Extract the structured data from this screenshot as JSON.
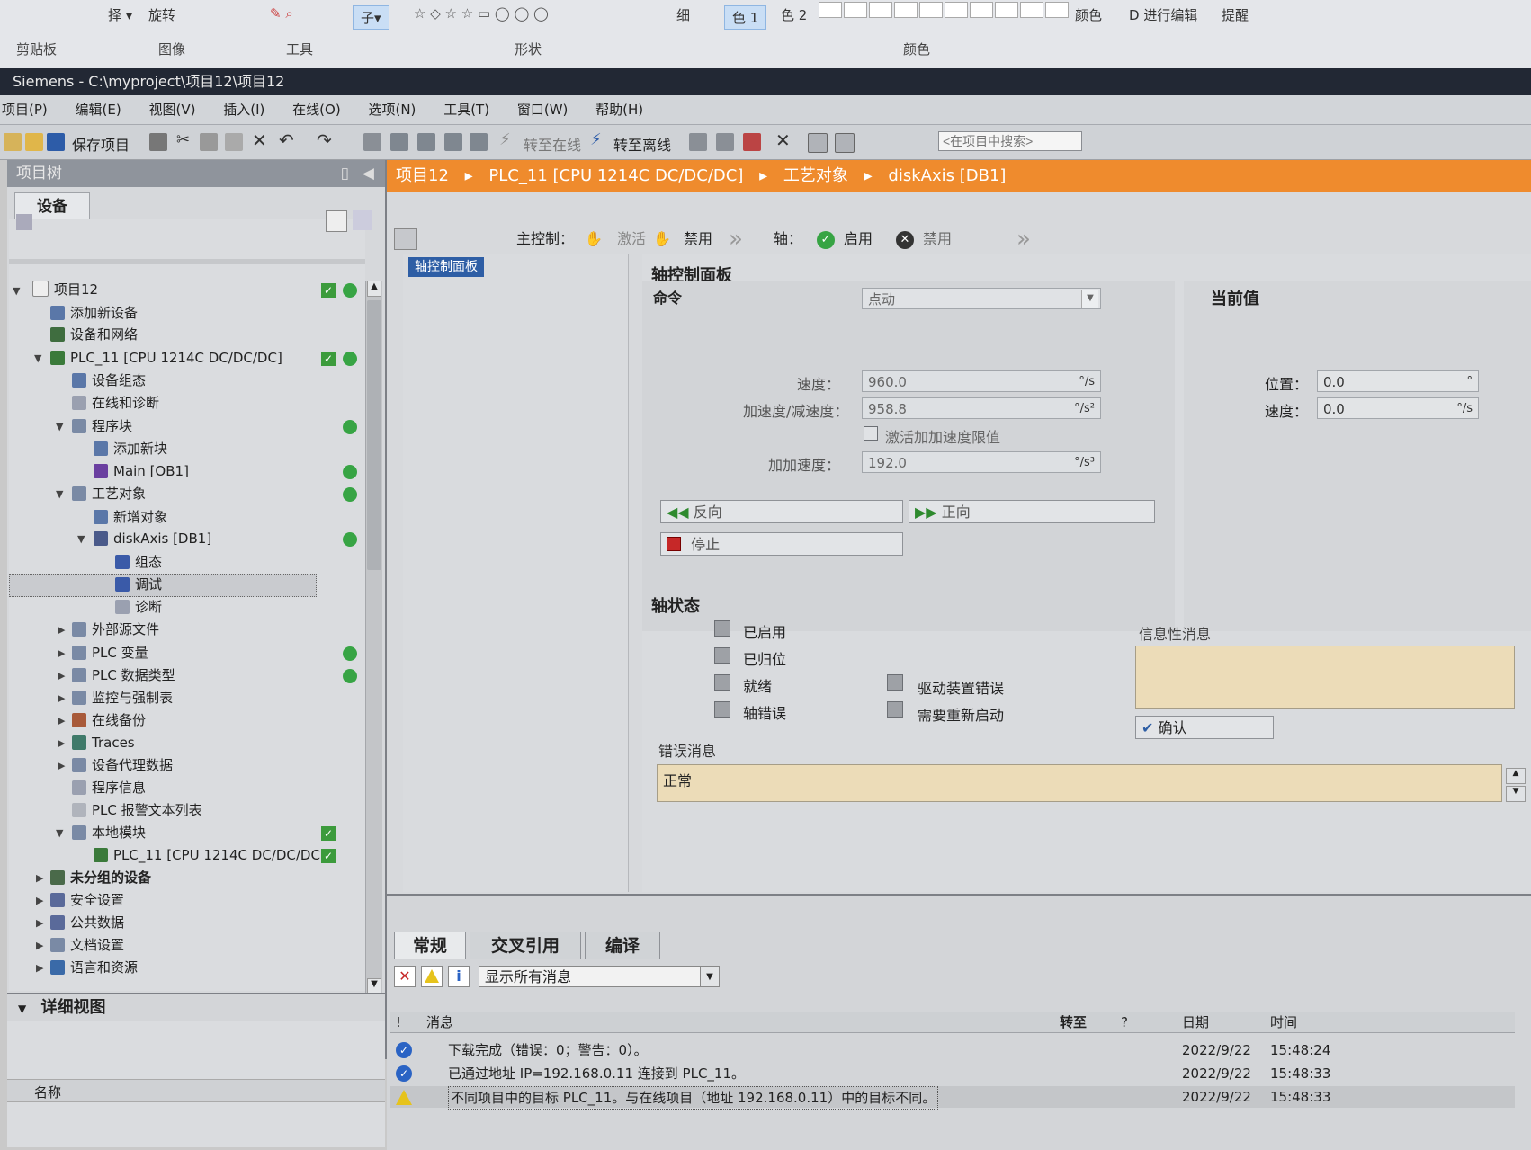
{
  "ribbon": {
    "clipboard": "剪贴板",
    "image": "图像",
    "tools": "工具",
    "shapes": "形状",
    "colors": "颜色",
    "rotate": "旋转",
    "size": "细",
    "color1": "色 1",
    "color2": "色 2",
    "edit_colors": "颜色",
    "edit_3d": "D 进行编辑",
    "tip": "提醒"
  },
  "window": {
    "title": "Siemens  -  C:\\myproject\\项目12\\项目12"
  },
  "menu": [
    "项目(P)",
    "编辑(E)",
    "视图(V)",
    "插入(I)",
    "在线(O)",
    "选项(N)",
    "工具(T)",
    "窗口(W)",
    "帮助(H)"
  ],
  "toolbar": {
    "save": "保存项目",
    "go_online": "转至在线",
    "go_offline": "转至离线",
    "search_placeholder": "<在项目中搜索>"
  },
  "tree": {
    "header": "项目树",
    "tab": "设备",
    "items": [
      {
        "label": "项目12"
      },
      {
        "label": "添加新设备"
      },
      {
        "label": "设备和网络"
      },
      {
        "label": "PLC_11 [CPU 1214C DC/DC/DC]"
      },
      {
        "label": "设备组态"
      },
      {
        "label": "在线和诊断"
      },
      {
        "label": "程序块"
      },
      {
        "label": "添加新块"
      },
      {
        "label": "Main [OB1]"
      },
      {
        "label": "工艺对象"
      },
      {
        "label": "新增对象"
      },
      {
        "label": "diskAxis [DB1]"
      },
      {
        "label": "组态"
      },
      {
        "label": "调试"
      },
      {
        "label": "诊断"
      },
      {
        "label": "外部源文件"
      },
      {
        "label": "PLC 变量"
      },
      {
        "label": "PLC 数据类型"
      },
      {
        "label": "监控与强制表"
      },
      {
        "label": "在线备份"
      },
      {
        "label": "Traces"
      },
      {
        "label": "设备代理数据"
      },
      {
        "label": "程序信息"
      },
      {
        "label": "PLC 报警文本列表"
      },
      {
        "label": "本地模块"
      },
      {
        "label": "PLC_11 [CPU 1214C DC/DC/DC]"
      },
      {
        "label": "未分组的设备"
      },
      {
        "label": "安全设置"
      },
      {
        "label": "公共数据"
      },
      {
        "label": "文档设置"
      },
      {
        "label": "语言和资源"
      }
    ],
    "detail_view": "详细视图",
    "detail_col_name": "名称"
  },
  "breadcrumb": [
    "项目12",
    "PLC_11 [CPU 1214C DC/DC/DC]",
    "工艺对象",
    "diskAxis [DB1]"
  ],
  "editor_toolbar": {
    "master_control": "主控制：",
    "activate": "激活",
    "disable": "禁用",
    "axis": "轴：",
    "enable": "启用",
    "axis_disable": "禁用"
  },
  "nav": {
    "item": "轴控制面板"
  },
  "panel": {
    "title": "轴控制面板",
    "command_label": "命令",
    "command_value": "点动",
    "current_label": "当前值",
    "speed_label": "速度：",
    "speed_value": "960.0",
    "speed_unit": "°/s",
    "accel_label": "加速度/减速度：",
    "accel_value": "958.8",
    "accel_unit": "°/s²",
    "jerk_checkbox": "激活加加速度限值",
    "jerk_label": "加加速度：",
    "jerk_value": "192.0",
    "jerk_unit": "°/s³",
    "pos_label": "位置：",
    "pos_value": "0.0",
    "pos_unit": "°",
    "cur_speed_label": "速度：",
    "cur_speed_value": "0.0",
    "cur_speed_unit": "°/s",
    "reverse": "反向",
    "forward": "正向",
    "stop": "停止",
    "status_title": "轴状态",
    "enabled": "已启用",
    "homed": "已归位",
    "ready": "就绪",
    "axis_error": "轴错误",
    "drive_error": "驱动装置错误",
    "restart_required": "需要重新启动",
    "info_title": "信息性消息",
    "confirm": "确认",
    "error_title": "错误消息",
    "error_value": "正常"
  },
  "output": {
    "tabs": [
      "常规",
      "交叉引用",
      "编译"
    ],
    "filter": "显示所有消息",
    "headers": {
      "msg": "消息",
      "goto": "转至",
      "q": "?",
      "date": "日期",
      "time": "时间",
      "bang": "!"
    },
    "rows": [
      {
        "type": "ok",
        "msg": "下载完成（错误：0；警告：0）。",
        "date": "2022/9/22",
        "time": "15:48:24"
      },
      {
        "type": "ok",
        "msg": "已通过地址 IP=192.168.0.11 连接到 PLC_11。",
        "date": "2022/9/22",
        "time": "15:48:33"
      },
      {
        "type": "warn",
        "msg": "不同项目中的目标 PLC_11。与在线项目（地址 192.168.0.11）中的目标不同。",
        "date": "2022/9/22",
        "time": "15:48:33"
      }
    ]
  },
  "colors": {
    "accent": "#ef8b2d",
    "selection": "#2e5ea5",
    "ok": "#37a444"
  }
}
